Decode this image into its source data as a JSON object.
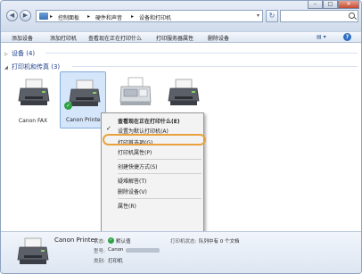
{
  "window": {
    "nav_back": "◀",
    "nav_forward": "▶",
    "breadcrumb": [
      "控制面板",
      "硬件和声音",
      "设备和打印机"
    ],
    "breadcrumb_sep": "▸",
    "refresh_icon": "refresh-icon",
    "search_placeholder": "",
    "controls": {
      "minimize": "–",
      "maximize": "□",
      "close": "✕"
    }
  },
  "toolbar": {
    "items": [
      "添加设备",
      "添加打印机",
      "查看现在正在打印什么",
      "打印服务器属性",
      "删除设备"
    ],
    "view_label": "▤ ▾",
    "help_label": "?"
  },
  "groups": {
    "devices": {
      "label": "设备 (4)",
      "arrow": "▷"
    },
    "printers": {
      "label": "打印机和传真 (3)",
      "arrow": "◢"
    }
  },
  "printers": [
    {
      "label": "Canon FAX",
      "selected": false,
      "default": false
    },
    {
      "label": "Canon Printer",
      "selected": true,
      "default": true
    },
    {
      "label": "",
      "selected": false,
      "default": false
    },
    {
      "label": "",
      "selected": false,
      "default": false
    }
  ],
  "context_menu": {
    "items": [
      {
        "label": "查看现在正在打印什么(E)",
        "bold": true,
        "checked": false
      },
      {
        "label": "设置为默认打印机(A)",
        "bold": false,
        "checked": true
      },
      {
        "label": "打印首选项(G)",
        "bold": false,
        "checked": false,
        "highlighted": true
      },
      {
        "label": "打印机属性(P)",
        "bold": false,
        "checked": false
      },
      {
        "label": "创建快捷方式(S)",
        "bold": false,
        "checked": false
      },
      {
        "label": "疑难解答(T)",
        "bold": false,
        "checked": false
      },
      {
        "label": "删除设备(V)",
        "bold": false,
        "checked": false
      },
      {
        "label": "属性(R)",
        "bold": false,
        "checked": false
      }
    ],
    "check_mark": "✓"
  },
  "details": {
    "name": "Canon Printer",
    "state_label": "状态:",
    "state_value": "默认值",
    "model_label": "型号:",
    "model_value": "Canon",
    "category_label": "类别:",
    "category_value": "打印机",
    "printer_status_label": "打印机状态:",
    "printer_status_value": "队列中有 0 个文档"
  },
  "colors": {
    "accent": "#1c3f8a",
    "highlight_ring": "#e8a23d",
    "selection": "#d5e6fb",
    "status_ok": "#2ea043"
  }
}
